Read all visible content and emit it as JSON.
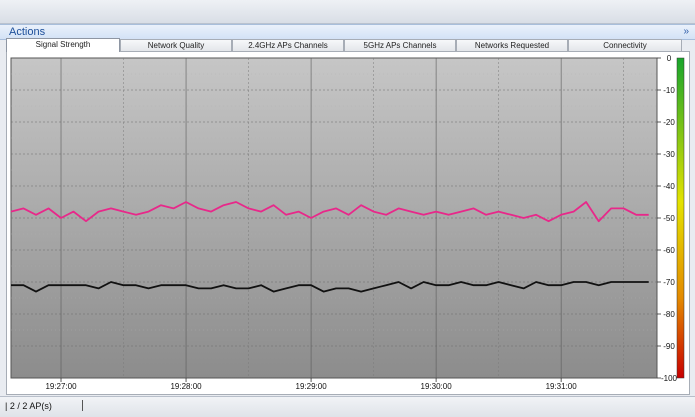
{
  "actions": {
    "title": "Actions",
    "collapse_icon": "double-chevron-down-icon"
  },
  "tabs": [
    {
      "label": "Signal Strength",
      "active": true
    },
    {
      "label": "Network Quality",
      "active": false
    },
    {
      "label": "2.4GHz APs Channels",
      "active": false
    },
    {
      "label": "5GHz APs Channels",
      "active": false
    },
    {
      "label": "Networks Requested",
      "active": false
    },
    {
      "label": "Connectivity",
      "active": false
    }
  ],
  "status": {
    "ap_count": "2 / 2 AP(s)"
  },
  "chart_data": {
    "type": "line",
    "x": [
      "19:26:36",
      "19:26:42",
      "19:26:48",
      "19:26:54",
      "19:27:00",
      "19:27:06",
      "19:27:12",
      "19:27:18",
      "19:27:24",
      "19:27:30",
      "19:27:36",
      "19:27:42",
      "19:27:48",
      "19:27:54",
      "19:28:00",
      "19:28:06",
      "19:28:12",
      "19:28:18",
      "19:28:24",
      "19:28:30",
      "19:28:36",
      "19:28:42",
      "19:28:48",
      "19:28:54",
      "19:29:00",
      "19:29:06",
      "19:29:12",
      "19:29:18",
      "19:29:24",
      "19:29:30",
      "19:29:36",
      "19:29:42",
      "19:29:48",
      "19:29:54",
      "19:30:00",
      "19:30:06",
      "19:30:12",
      "19:30:18",
      "19:30:24",
      "19:30:30",
      "19:30:36",
      "19:30:42",
      "19:30:48",
      "19:30:54",
      "19:31:00",
      "19:31:06",
      "19:31:12",
      "19:31:18",
      "19:31:24",
      "19:31:30",
      "19:31:36",
      "19:31:42"
    ],
    "x_ticks": [
      "19:27:00",
      "19:28:00",
      "19:29:00",
      "19:30:00",
      "19:31:00"
    ],
    "xlim": [
      "19:26:36",
      "19:31:46"
    ],
    "ylim": [
      -100,
      0
    ],
    "y_ticks": [
      0,
      -10,
      -20,
      -30,
      -40,
      -50,
      -60,
      -70,
      -80,
      -90,
      -100
    ],
    "y_axis_position": "right",
    "grid": true,
    "series": [
      {
        "color": "#e8288a",
        "values": [
          -48,
          -47,
          -49,
          -47,
          -50,
          -48,
          -51,
          -48,
          -47,
          -48,
          -49,
          -48,
          -46,
          -47,
          -45,
          -47,
          -48,
          -46,
          -45,
          -47,
          -48,
          -46,
          -49,
          -48,
          -50,
          -48,
          -47,
          -49,
          -46,
          -48,
          -49,
          -47,
          -48,
          -49,
          -48,
          -49,
          -48,
          -47,
          -49,
          -48,
          -49,
          -50,
          -49,
          -51,
          -49,
          -48,
          -45,
          -51,
          -47,
          -47,
          -49,
          -49
        ]
      },
      {
        "color": "#111111",
        "values": [
          -71,
          -71,
          -73,
          -71,
          -71,
          -71,
          -71,
          -72,
          -70,
          -71,
          -71,
          -72,
          -71,
          -71,
          -71,
          -72,
          -72,
          -71,
          -72,
          -72,
          -71,
          -73,
          -72,
          -71,
          -71,
          -73,
          -72,
          -72,
          -73,
          -72,
          -71,
          -70,
          -72,
          -70,
          -71,
          -71,
          -70,
          -71,
          -71,
          -70,
          -71,
          -72,
          -70,
          -71,
          -71,
          -70,
          -70,
          -71,
          -70,
          -70,
          -70,
          -70
        ]
      }
    ]
  }
}
